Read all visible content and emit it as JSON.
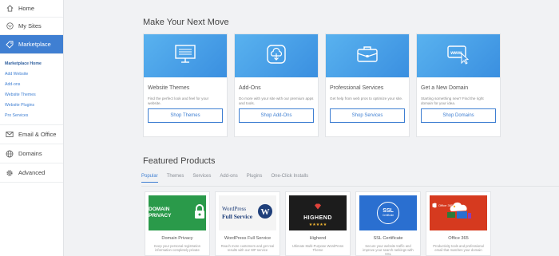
{
  "sidebar": {
    "top_items": [
      {
        "label": "Home",
        "icon": "home-icon"
      },
      {
        "label": "My Sites",
        "icon": "wordpress-icon"
      },
      {
        "label": "Marketplace",
        "icon": "tag-icon"
      }
    ],
    "sub_items": [
      "Marketplace Home",
      "Add Website",
      "Add-ons",
      "Website Themes",
      "Website Plugins",
      "Pro Services"
    ],
    "bottom_items": [
      {
        "label": "Email & Office",
        "icon": "mail-icon"
      },
      {
        "label": "Domains",
        "icon": "globe-icon"
      },
      {
        "label": "Advanced",
        "icon": "gear-icon"
      }
    ]
  },
  "next_move": {
    "title": "Make Your Next Move",
    "cards": [
      {
        "title": "Website Themes",
        "desc": "Find the perfect look and feel for your website.",
        "button": "Shop Themes",
        "icon": "monitor-icon"
      },
      {
        "title": "Add-Ons",
        "desc": "Do more with your site with our premium apps and tools.",
        "button": "Shop Add-Ons",
        "icon": "download-cloud-icon"
      },
      {
        "title": "Professional Services",
        "desc": "Get help from web pros to optimize your site.",
        "button": "Shop Services",
        "icon": "briefcase-icon"
      },
      {
        "title": "Get a New Domain",
        "desc": "Starting something new? Find the right domain for your idea.",
        "button": "Shop Domains",
        "icon": "www-cursor-icon"
      }
    ]
  },
  "featured": {
    "title": "Featured Products",
    "tabs": [
      "Popular",
      "Themes",
      "Services",
      "Add-ons",
      "Plugins",
      "One-Click Installs"
    ],
    "products": [
      {
        "name": "Domain Privacy",
        "desc": "Keep your personal registration information completely private",
        "img_text": "DOMAIN PRIVACY",
        "color": "#2a9a4a"
      },
      {
        "name": "WordPress Full Service",
        "desc": "Reach more customers and get real results with our WP service",
        "img_text_1": "WordPress",
        "img_text_2": "Full Service",
        "color": "#1f3f7a"
      },
      {
        "name": "Highend",
        "desc": "Ultimate Multi-Purpose WordPress Theme",
        "img_text": "HIGHEND",
        "stars": "★★★★★",
        "color": "#1c1c1c"
      },
      {
        "name": "SSL Certificate",
        "desc": "Secure your website traffic and improve your search rankings with SSL",
        "img_text_1": "SSL",
        "img_text_2": "Certificate",
        "color": "#2a6fd0"
      },
      {
        "name": "Office 365",
        "desc": "Productivity tools and professional email that matches your domain",
        "img_text": "Office 365",
        "color": "#d63a1f"
      }
    ]
  }
}
